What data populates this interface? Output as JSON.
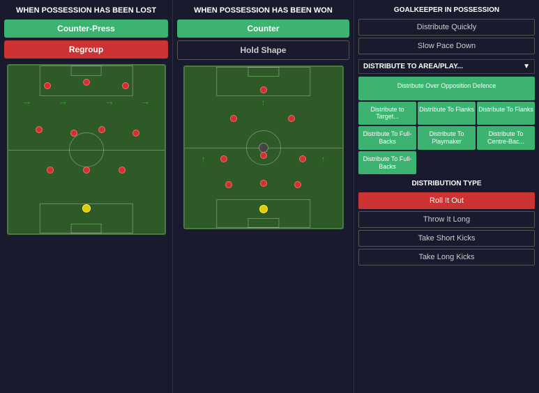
{
  "left_panel": {
    "title": "WHEN POSSESSION HAS BEEN LOST",
    "btn1": "Counter-Press",
    "btn2": "Regroup"
  },
  "mid_panel": {
    "title": "WHEN POSSESSION HAS BEEN WON",
    "btn1": "Counter",
    "btn2": "Hold Shape"
  },
  "right_panel": {
    "title": "GOALKEEPER IN POSSESSION",
    "btn1": "Distribute Quickly",
    "btn2": "Slow Pace Down",
    "dist_header": "DISTRIBUTE TO AREA/PLAY...",
    "dist_cells": [
      {
        "label": "Distribute Over Opposition Defence",
        "span": "full"
      },
      {
        "label": "Distribute to Target...",
        "span": "1"
      },
      {
        "label": "Distribute To Flanks",
        "span": "1"
      },
      {
        "label": "Distribute To Flanks",
        "span": "1"
      },
      {
        "label": "Distribute To Playmaker",
        "span": "1"
      },
      {
        "label": "Distribute To Full-Backs",
        "span": "1"
      },
      {
        "label": "Distribute To Centre-Bac...",
        "span": "1"
      },
      {
        "label": "Distribute To Full-Backs",
        "span": "1"
      }
    ],
    "dist_type_title": "DISTRIBUTION TYPE",
    "dist_type_btns": [
      {
        "label": "Roll It Out",
        "active": true
      },
      {
        "label": "Throw It Long",
        "active": false
      },
      {
        "label": "Take Short Kicks",
        "active": false
      },
      {
        "label": "Take Long Kicks",
        "active": false
      }
    ]
  }
}
